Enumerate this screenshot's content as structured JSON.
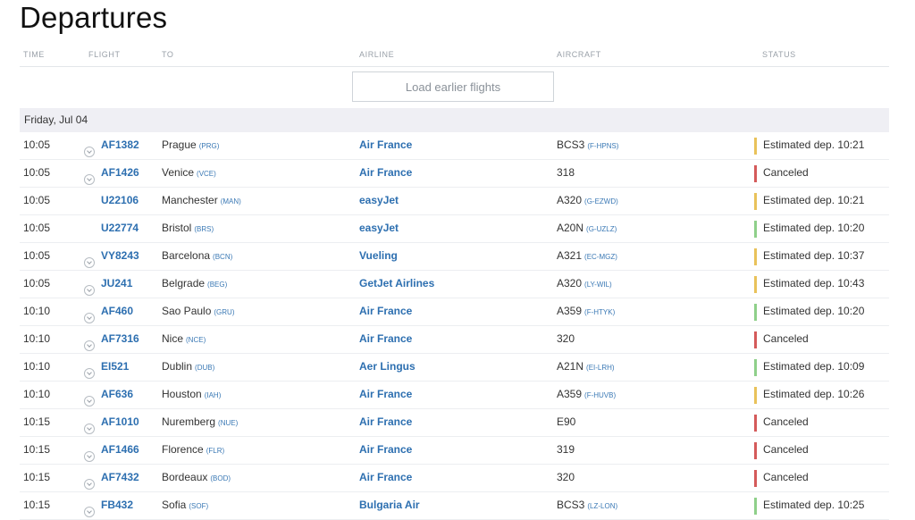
{
  "title": "Departures",
  "columns": {
    "time": "TIME",
    "flight": "FLIGHT",
    "to": "TO",
    "airline": "AIRLINE",
    "aircraft": "AIRCRAFT",
    "status": "STATUS"
  },
  "load_earlier": "Load earlier flights",
  "day_label": "Friday, Jul 04",
  "status_colors": {
    "estimated-yellow": "#e9c25a",
    "estimated-green": "#8fd08a",
    "canceled": "#d45a5a"
  },
  "flights": [
    {
      "time": "10:05",
      "expandable": true,
      "flight": "AF1382",
      "dest": "Prague",
      "dest_code": "(PRG)",
      "airline": "Air France",
      "aircraft": "BCS3",
      "reg": "(F-HPNS)",
      "status": "Estimated dep. 10:21",
      "status_color": "#e9c25a"
    },
    {
      "time": "10:05",
      "expandable": true,
      "flight": "AF1426",
      "dest": "Venice",
      "dest_code": "(VCE)",
      "airline": "Air France",
      "aircraft": "318",
      "reg": "",
      "status": "Canceled",
      "status_color": "#d45a5a"
    },
    {
      "time": "10:05",
      "expandable": false,
      "flight": "U22106",
      "dest": "Manchester",
      "dest_code": "(MAN)",
      "airline": "easyJet",
      "aircraft": "A320",
      "reg": "(G-EZWD)",
      "status": "Estimated dep. 10:21",
      "status_color": "#e9c25a"
    },
    {
      "time": "10:05",
      "expandable": false,
      "flight": "U22774",
      "dest": "Bristol",
      "dest_code": "(BRS)",
      "airline": "easyJet",
      "aircraft": "A20N",
      "reg": "(G-UZLZ)",
      "status": "Estimated dep. 10:20",
      "status_color": "#8fd08a"
    },
    {
      "time": "10:05",
      "expandable": true,
      "flight": "VY8243",
      "dest": "Barcelona",
      "dest_code": "(BCN)",
      "airline": "Vueling",
      "aircraft": "A321",
      "reg": "(EC-MGZ)",
      "status": "Estimated dep. 10:37",
      "status_color": "#e9c25a"
    },
    {
      "time": "10:05",
      "expandable": true,
      "flight": "JU241",
      "dest": "Belgrade",
      "dest_code": "(BEG)",
      "airline": "GetJet Airlines",
      "aircraft": "A320",
      "reg": "(LY-WIL)",
      "status": "Estimated dep. 10:43",
      "status_color": "#e9c25a"
    },
    {
      "time": "10:10",
      "expandable": true,
      "flight": "AF460",
      "dest": "Sao Paulo",
      "dest_code": "(GRU)",
      "airline": "Air France",
      "aircraft": "A359",
      "reg": "(F-HTYK)",
      "status": "Estimated dep. 10:20",
      "status_color": "#8fd08a"
    },
    {
      "time": "10:10",
      "expandable": true,
      "flight": "AF7316",
      "dest": "Nice",
      "dest_code": "(NCE)",
      "airline": "Air France",
      "aircraft": "320",
      "reg": "",
      "status": "Canceled",
      "status_color": "#d45a5a"
    },
    {
      "time": "10:10",
      "expandable": true,
      "flight": "EI521",
      "dest": "Dublin",
      "dest_code": "(DUB)",
      "airline": "Aer Lingus",
      "aircraft": "A21N",
      "reg": "(EI-LRH)",
      "status": "Estimated dep. 10:09",
      "status_color": "#8fd08a"
    },
    {
      "time": "10:10",
      "expandable": true,
      "flight": "AF636",
      "dest": "Houston",
      "dest_code": "(IAH)",
      "airline": "Air France",
      "aircraft": "A359",
      "reg": "(F-HUVB)",
      "status": "Estimated dep. 10:26",
      "status_color": "#e9c25a"
    },
    {
      "time": "10:15",
      "expandable": true,
      "flight": "AF1010",
      "dest": "Nuremberg",
      "dest_code": "(NUE)",
      "airline": "Air France",
      "aircraft": "E90",
      "reg": "",
      "status": "Canceled",
      "status_color": "#d45a5a"
    },
    {
      "time": "10:15",
      "expandable": true,
      "flight": "AF1466",
      "dest": "Florence",
      "dest_code": "(FLR)",
      "airline": "Air France",
      "aircraft": "319",
      "reg": "",
      "status": "Canceled",
      "status_color": "#d45a5a"
    },
    {
      "time": "10:15",
      "expandable": true,
      "flight": "AF7432",
      "dest": "Bordeaux",
      "dest_code": "(BOD)",
      "airline": "Air France",
      "aircraft": "320",
      "reg": "",
      "status": "Canceled",
      "status_color": "#d45a5a"
    },
    {
      "time": "10:15",
      "expandable": true,
      "flight": "FB432",
      "dest": "Sofia",
      "dest_code": "(SOF)",
      "airline": "Bulgaria Air",
      "aircraft": "BCS3",
      "reg": "(LZ-LON)",
      "status": "Estimated dep. 10:25",
      "status_color": "#8fd08a"
    }
  ]
}
